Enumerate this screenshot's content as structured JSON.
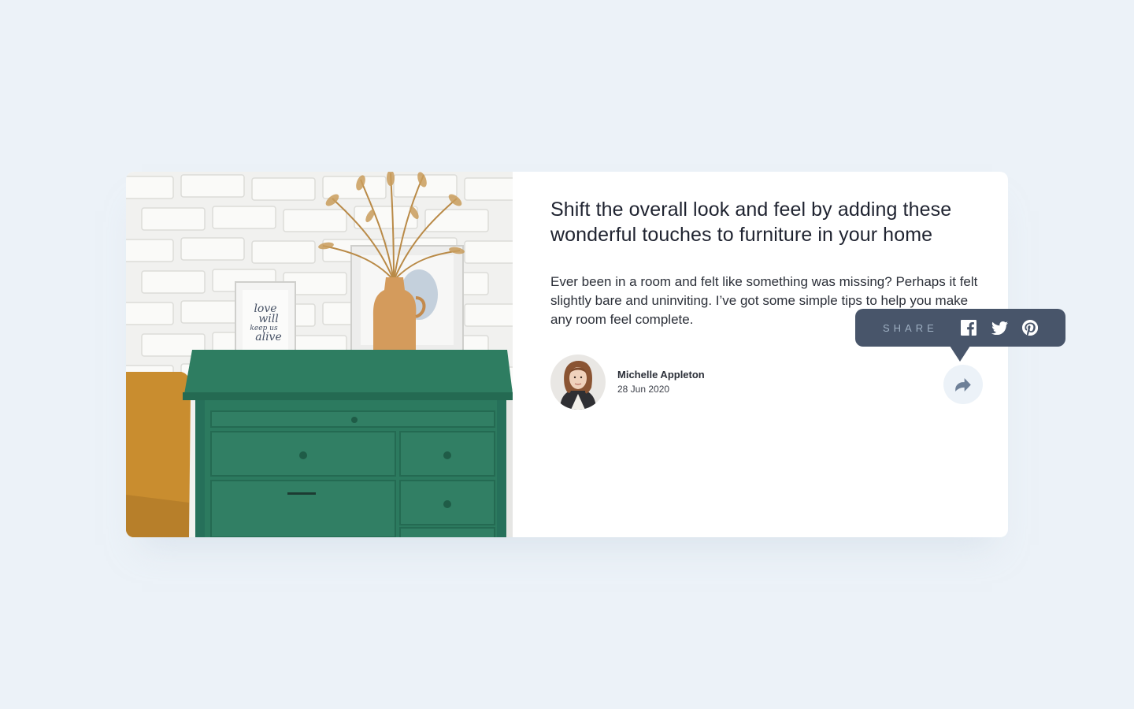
{
  "article": {
    "title": "Shift the overall look and feel by adding these wonderful touches to furniture in your home",
    "excerpt": "Ever been in a room and felt like something was missing? Perhaps it felt slightly bare and uninviting. I’ve got some simple tips to help you make any room feel complete.",
    "image_icon": "drawers-photo",
    "frame_text": [
      "love",
      "will",
      "keep us",
      "alive"
    ]
  },
  "author": {
    "name": "Michelle Appleton",
    "date": "28 Jun 2020",
    "avatar_icon": "avatar-photo"
  },
  "share": {
    "label": "SHARE",
    "button_icon": "share-icon",
    "networks": [
      {
        "name": "facebook",
        "icon": "facebook-icon"
      },
      {
        "name": "twitter",
        "icon": "twitter-icon"
      },
      {
        "name": "pinterest",
        "icon": "pinterest-icon"
      }
    ]
  },
  "colors": {
    "page_background": "#ecf2f8",
    "card_background": "#ffffff",
    "popup_background": "#48556a",
    "popup_label": "#9eafc2",
    "share_icon": "#6e8098",
    "dresser_green": "#2c7a5f"
  }
}
